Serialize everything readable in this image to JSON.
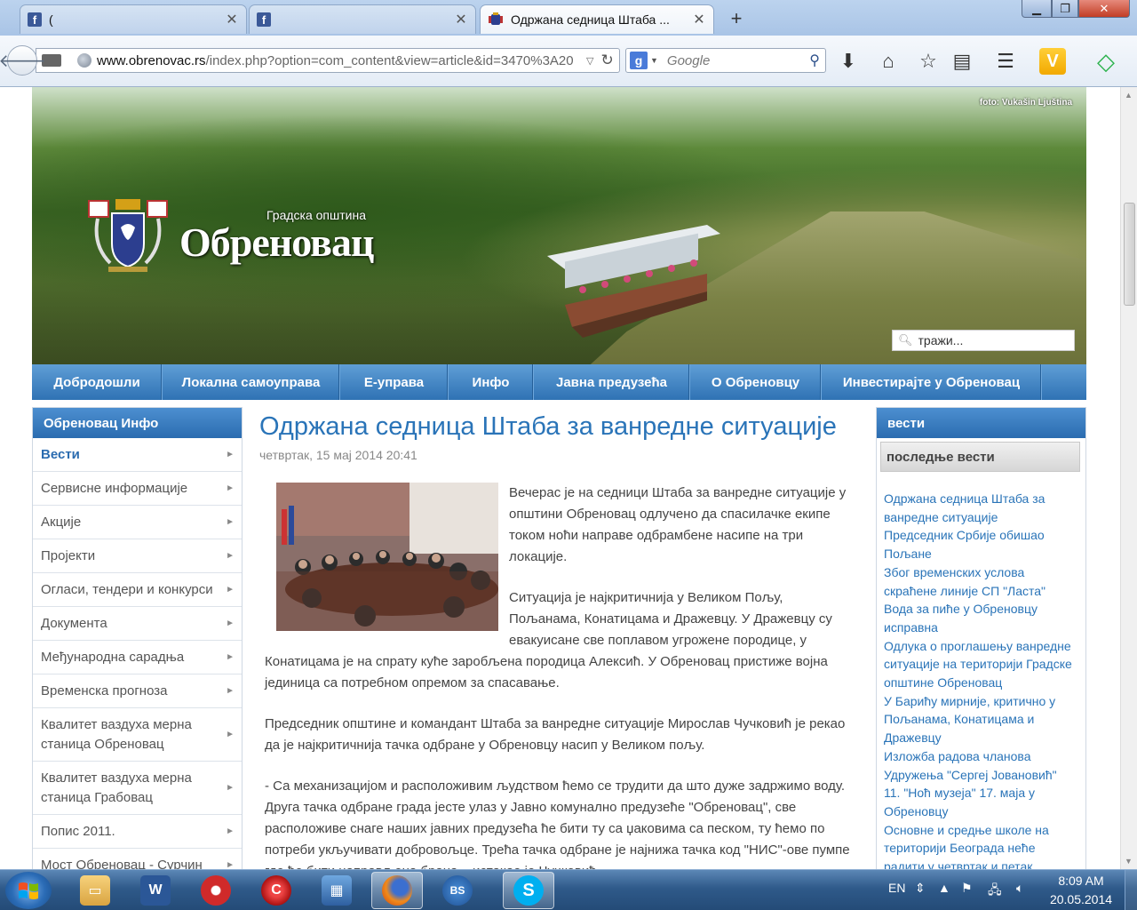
{
  "browser": {
    "tabs": [
      {
        "title": "(",
        "icon": "facebook-icon"
      },
      {
        "title": "",
        "icon": "facebook-icon"
      },
      {
        "title": "Одржана седница Штаба ...",
        "icon": "crest-icon"
      }
    ],
    "url_host": "www.obrenovac.rs",
    "url_rest": "/index.php?option=com_content&view=article&id=3470%3A20",
    "search_placeholder": "Google"
  },
  "header": {
    "photo_credit": "foto: Vukašin Ljuština",
    "logo_subtitle": "Градска општина",
    "logo_title": "Обреновац",
    "search_placeholder": "тражи..."
  },
  "mainnav": [
    {
      "label": "Добродошли"
    },
    {
      "label": "Локална самоуправа"
    },
    {
      "label": "Е-управа"
    },
    {
      "label": "Инфо"
    },
    {
      "label": "Јавна предузећа"
    },
    {
      "label": "О Обреновцу"
    },
    {
      "label": "Инвестирајте у Обреновац"
    }
  ],
  "left_sidebar": {
    "title": "Обреновац Инфо",
    "items": [
      {
        "label": "Вести"
      },
      {
        "label": "Сервисне информације"
      },
      {
        "label": "Акције"
      },
      {
        "label": "Пројекти"
      },
      {
        "label": "Огласи, тендери и конкурси"
      },
      {
        "label": "Документа"
      },
      {
        "label": "Међународна сарадња"
      },
      {
        "label": "Временска прогноза"
      },
      {
        "label": "Квалитет ваздуха мерна станица Обреновац"
      },
      {
        "label": "Квалитет ваздуха мерна станица Грабовац"
      },
      {
        "label": "Попис 2011."
      },
      {
        "label": "Мост Обреновац - Сурчин"
      }
    ]
  },
  "article": {
    "title": "Одржана седница Штаба за ванредне ситуације",
    "date": "четвртак, 15 мај 2014 20:41",
    "paragraphs": [
      "Вечерас је на седници Штаба за ванредне ситуације у општини Обреновац одлучено да спасилачке екипе током ноћи направе одбрамбене насипе на три локације.",
      "Ситуација је најкритичнија у Великом Пољу, Пољанама, Конатицама и Дражевцу. У Дражевцу су евакуисане све поплавом угрожене породице, у Конатицама је на спрату куће заробљена породица Алексић. У Обреновац пристиже војна јединица са потребном опремом за спасавање.",
      "Председник општине и командант Штаба за ванредне ситуације Мирослав Чучковић је рекао да је најкритичнија тачка одбране у Обреновцу насип у Великом пољу.",
      "- Са механизацијом и расположивим људством ћемо се трудити да што дуже задржимо воду. Друга тачка одбране града јесте улаз у Јавно комунално предузеће \"Обреновац\", све расположиве снаге наших јавних предузећа ће бити ту са џаковима са песком, ту ћемо по потреби укључивати добровољце. Трећа тачка одбране је најнижа тачка код \"НИС\"-ове пумпе где ће бити направљена брана – истакао је Чучковић."
    ]
  },
  "right_sidebar": {
    "title": "вести",
    "subtitle": "последње вести",
    "news": [
      "Одржана седница Штаба за ванредне ситуације",
      "Председник Србије обишао Пољане",
      "Због временских услова скраћене линије СП \"Ласта\"",
      "Вода за пиће у Обреновцу исправна",
      "Одлука о проглашењу ванредне ситуације на територији Градске општине Обреновац",
      "У Барићу мирније, критично у Пољанама, Конатицама и Дражевцу",
      "Изложба радова чланова Удружења \"Сергеј Јовановић\"",
      "11. \"Ноћ музеја\" 17. маја у Обреновцу",
      "Основне и средње школе на територији Београда неће радити у четвртак и петак"
    ]
  },
  "taskbar": {
    "language": "EN",
    "time": "8:09 AM",
    "date": "20.05.2014"
  },
  "colors": {
    "accent_blue": "#2a74b8",
    "nav_blue": "#2f72b4",
    "text_gray": "#444444"
  }
}
